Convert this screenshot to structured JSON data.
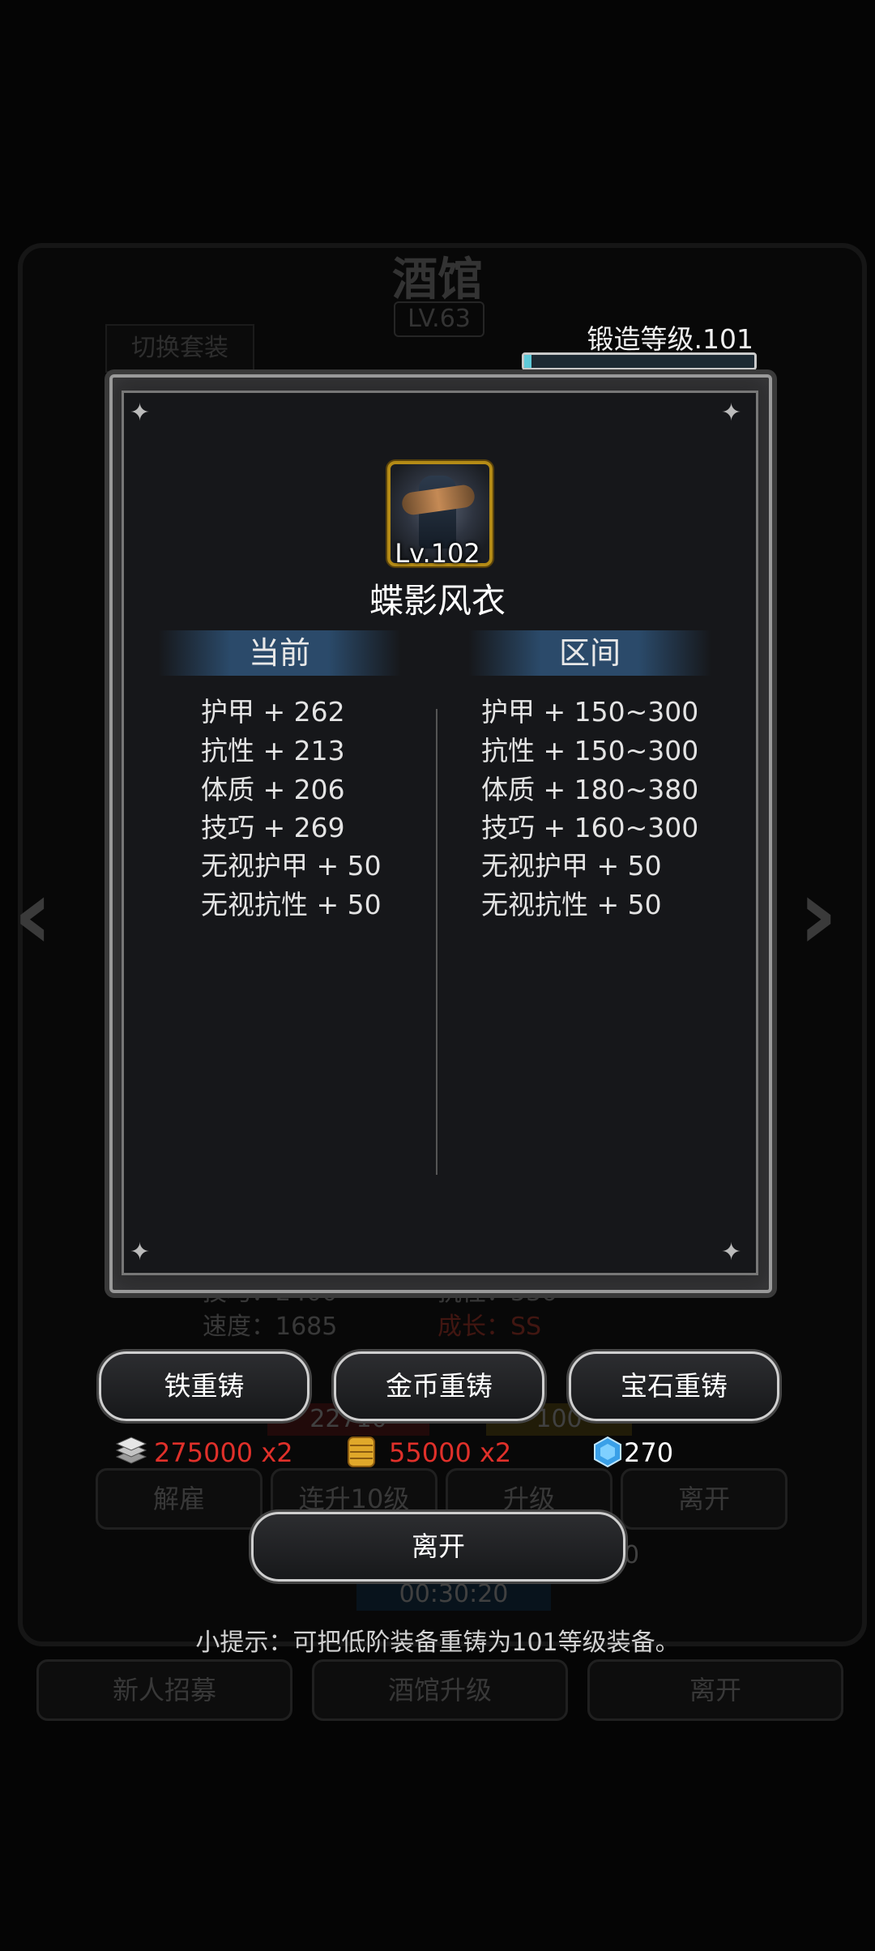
{
  "background": {
    "title": "酒馆",
    "level": "LV.63",
    "switch_label": "切换套装",
    "stats": [
      "技巧：2400",
      "抗性：536",
      "速度：1685",
      "成长：SS"
    ],
    "buttons": [
      "解雇",
      "连升10级",
      "升级",
      "离开"
    ],
    "bar_values": [
      "22710",
      "100",
      "00"
    ],
    "timer": "00:30:20",
    "bottom_buttons": [
      "新人招募",
      "酒馆升级",
      "离开"
    ]
  },
  "forge": {
    "label": "锻造等级.101",
    "progress": 0.03
  },
  "item": {
    "level": "Lv.102",
    "name": "蝶影风衣",
    "icon": "coat-icon"
  },
  "columns": {
    "current": "当前",
    "range": "区间"
  },
  "current_stats": [
    "护甲 + 262",
    "抗性 + 213",
    "体质 + 206",
    "技巧 + 269",
    "无视护甲 + 50",
    "无视抗性 + 50"
  ],
  "range_stats": [
    "护甲 + 150~300",
    "抗性 + 150~300",
    "体质 + 180~380",
    "技巧 + 160~300",
    "无视护甲 + 50",
    "无视抗性 + 50"
  ],
  "actions": {
    "iron": "铁重铸",
    "gold": "金币重铸",
    "gem": "宝石重铸",
    "leave": "离开"
  },
  "costs": {
    "iron": "275000 x2",
    "gold": "55000 x2",
    "gem": "270"
  },
  "colors": {
    "cost_insufficient": "#e0302a",
    "accent_gold": "#b48b16",
    "gem_blue": "#3aa0e8"
  },
  "tip": "小提示：可把低阶装备重铸为101等级装备。"
}
